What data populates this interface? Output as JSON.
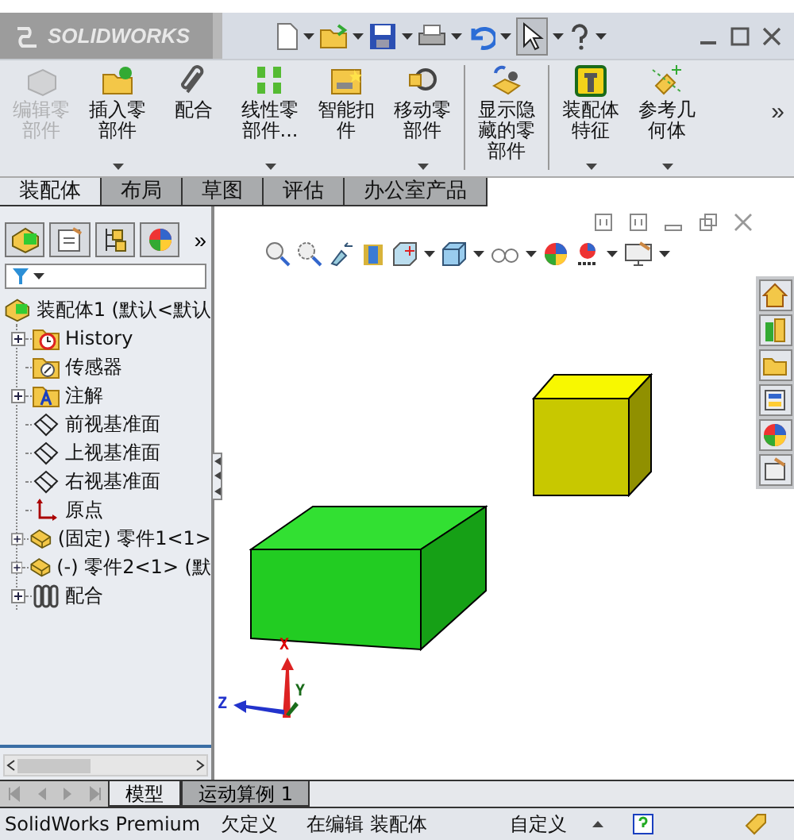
{
  "title_bar": {
    "logo": "SOLIDWORKS"
  },
  "ribbon": {
    "items": [
      {
        "label": "编辑零部件",
        "disabled": true,
        "dropdown": false,
        "separator_after": false
      },
      {
        "label": "插入零部件",
        "disabled": false,
        "dropdown": true,
        "separator_after": false
      },
      {
        "label": "配合",
        "disabled": false,
        "dropdown": false,
        "separator_after": false
      },
      {
        "label": "线性零部件...",
        "disabled": false,
        "dropdown": true,
        "separator_after": false
      },
      {
        "label": "智能扣件",
        "disabled": false,
        "dropdown": false,
        "separator_after": false
      },
      {
        "label": "移动零部件",
        "disabled": false,
        "dropdown": true,
        "separator_after": true
      },
      {
        "label": "显示隐藏的零部件",
        "disabled": false,
        "dropdown": false,
        "separator_after": true
      },
      {
        "label": "装配体特征",
        "disabled": false,
        "dropdown": true,
        "separator_after": false
      },
      {
        "label": "参考几何体",
        "disabled": false,
        "dropdown": true,
        "separator_after": false
      }
    ],
    "more": "»"
  },
  "tabs": [
    {
      "label": "装配体",
      "selected": true
    },
    {
      "label": "布局",
      "selected": false
    },
    {
      "label": "草图",
      "selected": false
    },
    {
      "label": "评估",
      "selected": false
    },
    {
      "label": "办公室产品",
      "selected": false
    }
  ],
  "feature_manager": {
    "more": "»",
    "root": {
      "label": "装配体1  (默认<默认",
      "children": [
        {
          "label": "History",
          "kind": "history",
          "collapsed": true
        },
        {
          "label": "传感器",
          "kind": "sensors",
          "collapsed": false
        },
        {
          "label": "注解",
          "kind": "annotations",
          "collapsed": true
        },
        {
          "label": "前视基准面",
          "kind": "plane",
          "collapsed": false
        },
        {
          "label": "上视基准面",
          "kind": "plane",
          "collapsed": false
        },
        {
          "label": "右视基准面",
          "kind": "plane",
          "collapsed": false
        },
        {
          "label": "原点",
          "kind": "origin",
          "collapsed": false
        },
        {
          "label": "(固定) 零件1<1>",
          "kind": "part",
          "collapsed": true
        },
        {
          "label": "(-) 零件2<1> (默",
          "kind": "part",
          "collapsed": true
        },
        {
          "label": "配合",
          "kind": "mates",
          "collapsed": true
        }
      ]
    }
  },
  "viewport": {
    "triad": {
      "x": "X",
      "y": "Y",
      "z": "Z"
    }
  },
  "bottom_tabs": [
    {
      "label": "模型",
      "selected": true
    },
    {
      "label": "运动算例 1",
      "selected": false
    }
  ],
  "status_bar": {
    "product": "SolidWorks Premium",
    "definition": "欠定义",
    "editing": "在编辑 装配体",
    "units": "自定义"
  }
}
